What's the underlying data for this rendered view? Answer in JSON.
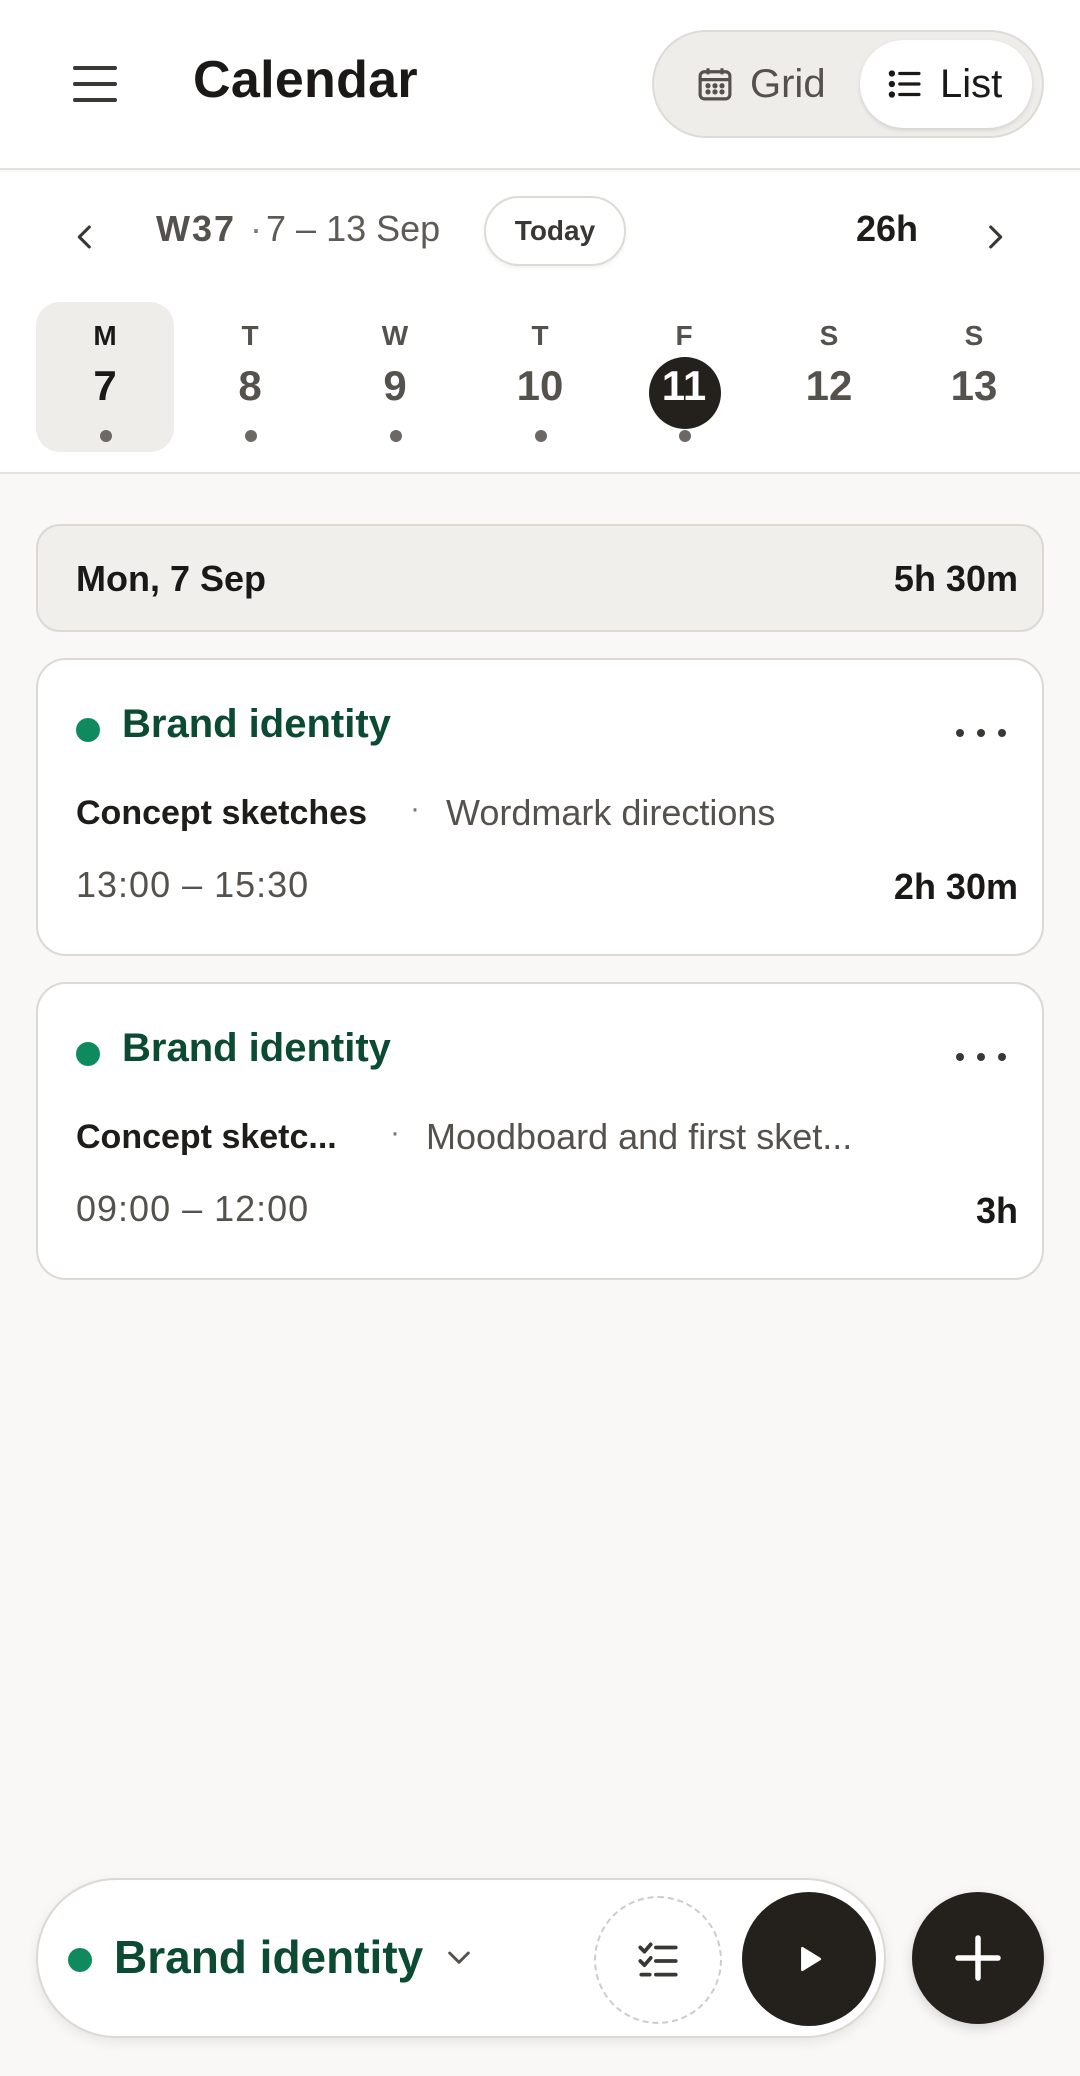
{
  "header": {
    "title": "Calendar",
    "view_toggle": {
      "grid_label": "Grid",
      "list_label": "List",
      "active": "List"
    }
  },
  "week_nav": {
    "week_number": "W37",
    "range": "7 – 13 Sep",
    "today_label": "Today",
    "total": "26h",
    "days": [
      {
        "letter": "M",
        "number": "7",
        "selected": true,
        "has_entries": true
      },
      {
        "letter": "T",
        "number": "8",
        "selected": false,
        "has_entries": true
      },
      {
        "letter": "W",
        "number": "9",
        "selected": false,
        "has_entries": true
      },
      {
        "letter": "T",
        "number": "10",
        "selected": false,
        "has_entries": true
      },
      {
        "letter": "F",
        "number": "11",
        "selected": false,
        "today": true,
        "has_entries": true
      },
      {
        "letter": "S",
        "number": "12",
        "selected": false,
        "has_entries": false
      },
      {
        "letter": "S",
        "number": "13",
        "selected": false,
        "has_entries": false
      }
    ]
  },
  "day_summary": {
    "date": "Mon, 7 Sep",
    "total": "5h 30m"
  },
  "entries": [
    {
      "project": "Brand identity",
      "project_color": "#0f8a5f",
      "task": "Concept sketches",
      "description": "Wordmark directions",
      "time_range": "13:00 – 15:30",
      "duration": "2h 30m"
    },
    {
      "project": "Brand identity",
      "project_color": "#0f8a5f",
      "task": "Concept sketc...",
      "description": "Moodboard and first sket...",
      "time_range": "09:00 – 12:00",
      "duration": "3h"
    }
  ],
  "tracker": {
    "project": "Brand identity",
    "project_color": "#0f8a5f"
  },
  "colors": {
    "accent_dark": "#24211d",
    "project_green": "#0f8a5f",
    "project_text": "#0b4a33"
  },
  "icons": [
    "menu-icon",
    "calendar-icon",
    "list-icon",
    "chevron-left-icon",
    "chevron-right-icon",
    "more-icon",
    "chevron-down-icon",
    "checklist-icon",
    "play-icon",
    "plus-icon"
  ]
}
